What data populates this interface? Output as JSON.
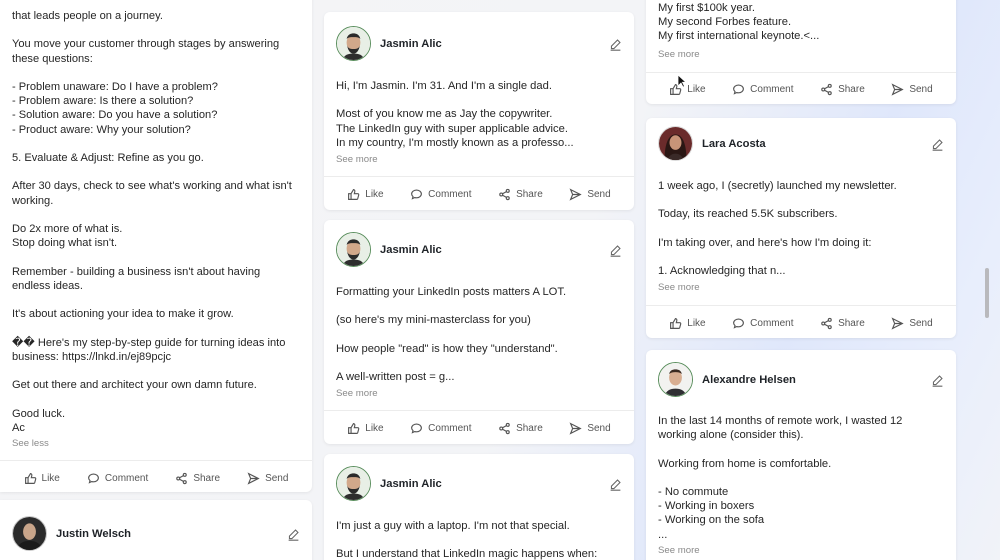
{
  "actions": {
    "like": "Like",
    "comment": "Comment",
    "share": "Share",
    "send": "Send"
  },
  "col1": {
    "post1": {
      "text": "that leads people on a journey.\n\nYou move your customer through stages by answering these questions:\n\n- Problem unaware: Do I have a problem?\n- Problem aware: Is there a solution?\n- Solution aware: Do you have a solution?\n- Product aware: Why your solution?\n\n5. Evaluate & Adjust: Refine as you go.\n\nAfter 30 days, check to see what's working and what isn't working.\n\nDo 2x more of what is.\nStop doing what isn't.\n\nRemember - building a business isn't about having endless ideas.\n\nIt's about actioning your idea to make it grow.\n\n�� Here's my step-by-step guide for turning ideas into business: https://lnkd.in/ej89pcjc\n\nGet out there and architect your own damn future.\n\nGood luck.\nAc",
      "toggle": "See less"
    },
    "post2": {
      "author": "Justin Welsch"
    }
  },
  "col2": {
    "post1": {
      "author": "Jasmin Alic",
      "text": "Hi, I'm Jasmin. I'm 31. And I'm a single dad.\n\nMost of you know me as Jay the copywriter.\nThe LinkedIn guy with super applicable advice.\nIn my country, I'm mostly known as a professo...",
      "toggle": "See more"
    },
    "post2": {
      "author": "Jasmin Alic",
      "text": "Formatting your LinkedIn posts matters A LOT.\n\n(so here's my mini-masterclass for you)\n\nHow people \"read\" is how they \"understand\".\n\nA well-written post = g...",
      "toggle": "See more"
    },
    "post3": {
      "author": "Jasmin Alic",
      "text": "I'm just a guy with a laptop. I'm not that special.\n\nBut I understand that LinkedIn magic happens when:"
    }
  },
  "col3": {
    "post1": {
      "text": "My first $100k year.\nMy second Forbes feature.\nMy first international keynote.<...",
      "toggle": "See more"
    },
    "post2": {
      "author": "Lara Acosta",
      "text": "1 week ago, I (secretly) launched my newsletter.\n\nToday, its reached 5.5K subscribers.\n\nI'm taking over, and here's how I'm doing it:\n\n1. Acknowledging that n...",
      "toggle": "See more"
    },
    "post3": {
      "author": "Alexandre Helsen",
      "text": "In the last 14 months of remote work, I wasted 12 working alone (consider this).\n\nWorking from home is comfortable.\n\n- No commute\n- Working in boxers\n- Working on the sofa\n...",
      "toggle": "See more"
    }
  },
  "colors": {
    "accent": "#5b8f5e",
    "text": "#262626",
    "muted": "#8a8a8a"
  }
}
